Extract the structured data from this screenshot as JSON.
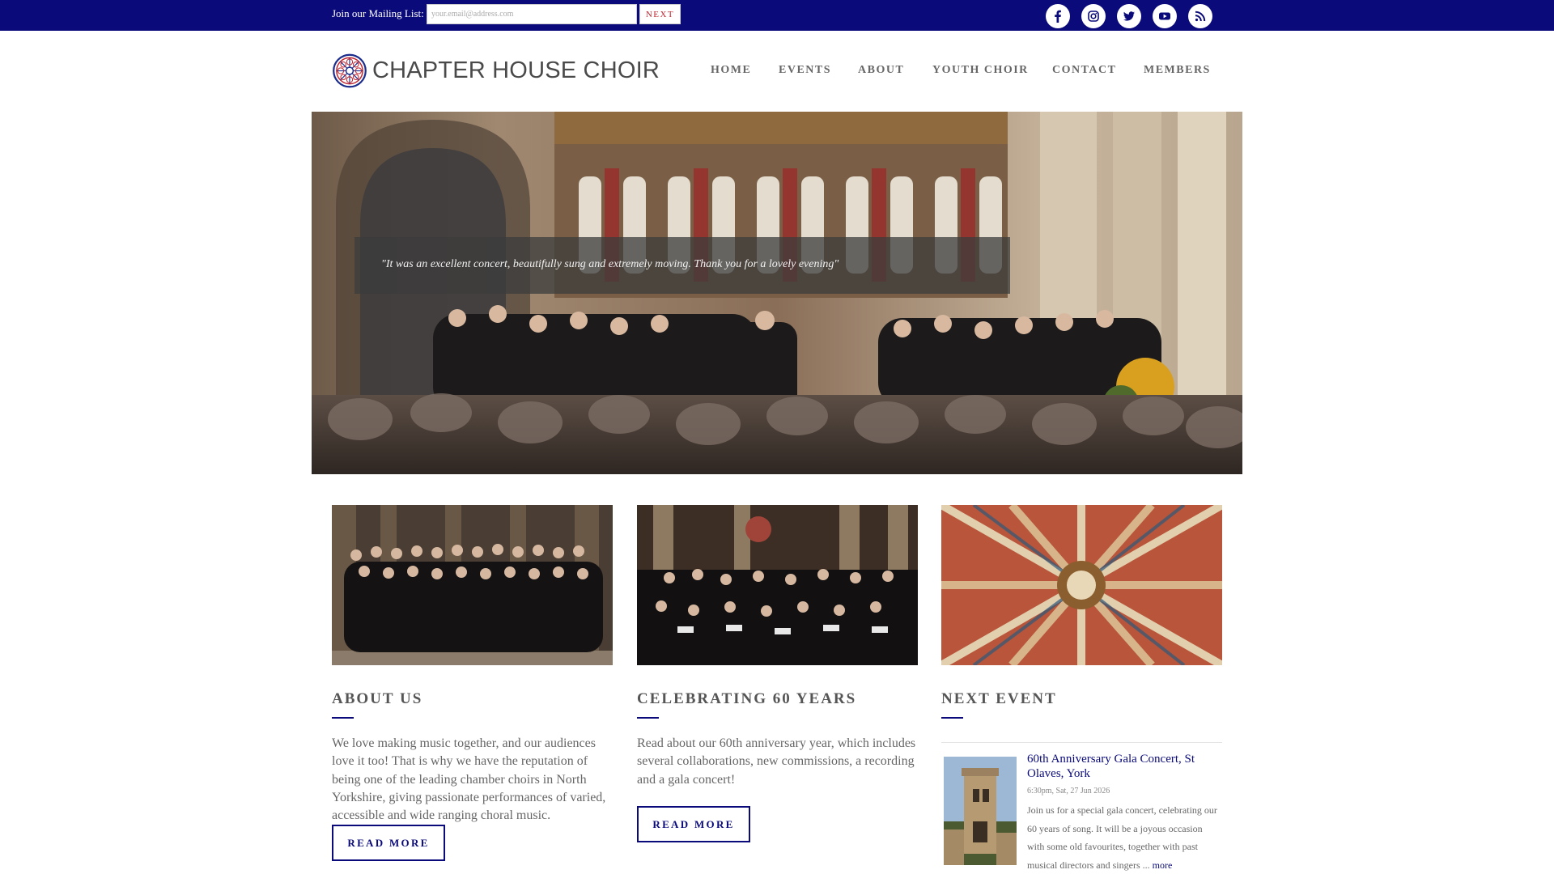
{
  "topbar": {
    "mailing_label": "Join our Mailing List:",
    "email_placeholder": "your.email@address.com",
    "next_label": "NEXT",
    "background": "#0a0a7a",
    "social_icons": [
      "facebook-icon",
      "instagram-icon",
      "twitter-icon",
      "youtube-icon",
      "rss-icon"
    ]
  },
  "header": {
    "logo_text": "CHAPTER HOUSE CHOIR",
    "nav": [
      "HOME",
      "EVENTS",
      "ABOUT",
      "YOUTH CHOIR",
      "CONTACT",
      "MEMBERS"
    ]
  },
  "hero": {
    "quote": "\"It was an excellent concert, beautifully sung and extremely moving. Thank you for a lovely evening\""
  },
  "about": {
    "title": "ABOUT US",
    "text": "We love making music together, and our audiences love it too!  That is why we have the reputation of being one of the leading chamber choirs in North Yorkshire, giving passionate performances of varied, accessible and wide ranging choral music.",
    "button": "READ MORE"
  },
  "celebrating": {
    "title": "CELEBRATING 60 YEARS",
    "text": "Read about our 60th anniversary year, which includes several collaborations, new commissions, a recording and a gala concert!",
    "button": "READ MORE"
  },
  "next_event": {
    "title": "NEXT EVENT",
    "event_title": "60th Anniversary Gala Concert, St Olaves, York",
    "event_date": "6:30pm, Sat, 27 Jun 2026",
    "event_desc": "Join us for a special gala concert, celebrating our 60 years of song. It will be a joyous occasion with some old favourites, together with past musical directors and singers ...",
    "more": "more"
  },
  "colors": {
    "accent": "#0a0a7a",
    "next_text": "#c0242f",
    "logo_red": "#c0242f",
    "logo_blue": "#1c2d8c"
  }
}
